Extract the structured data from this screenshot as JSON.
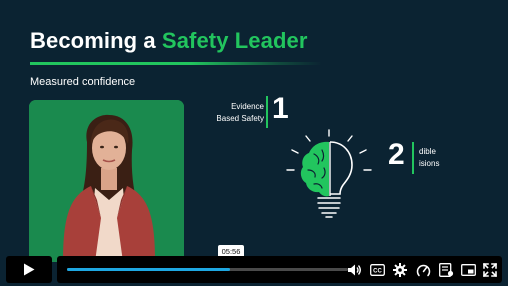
{
  "slide": {
    "title_prefix": "Becoming a ",
    "title_accent": "Safety Leader",
    "subtitle": "Measured confidence",
    "point1": {
      "number": "1",
      "line1": "Evidence",
      "line2": "Based Safety"
    },
    "point2": {
      "number": "2",
      "line1": "dible",
      "line2": "isions"
    }
  },
  "player": {
    "tooltip_time": "05:56",
    "progress": 0.58,
    "accent_color": "#1ea7e1",
    "icons": [
      "play-icon",
      "volume-icon",
      "closed-captions-icon",
      "settings-gear-icon",
      "playback-speed-icon",
      "chapters-icon",
      "picture-in-picture-icon",
      "fullscreen-icon"
    ]
  },
  "colors": {
    "background": "#0b2332",
    "brand_green": "#22c55e",
    "presenter_bg": "#1a8a4e"
  }
}
